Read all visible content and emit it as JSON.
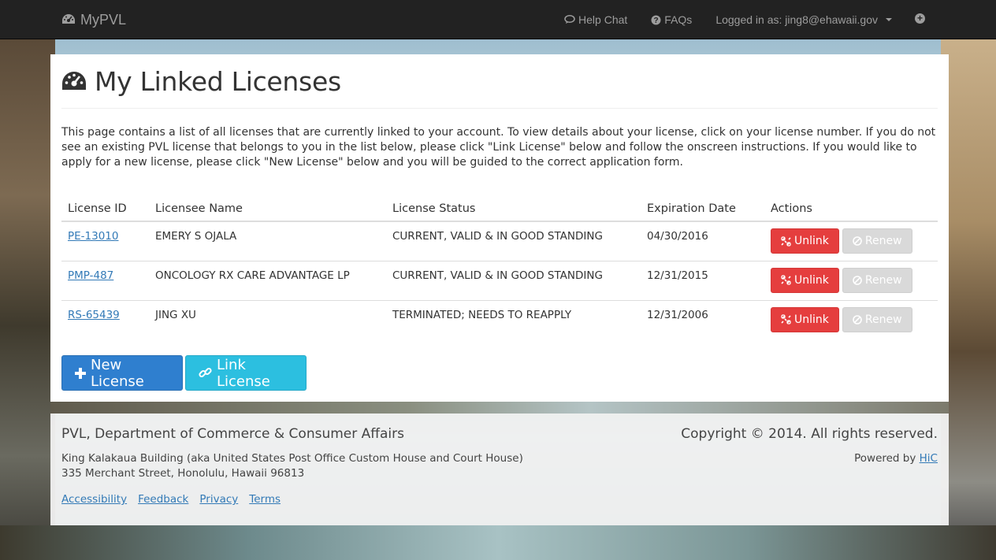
{
  "navbar": {
    "brand": "MyPVL",
    "help_chat": "Help Chat",
    "faqs": "FAQs",
    "logged_in": "Logged in as: jing8@ehawaii.gov"
  },
  "page": {
    "title": "My Linked Licenses",
    "intro": "This page contains a list of all licenses that are currently linked to your account. To view details about your license, click on your license number. If you do not see an existing PVL license that belongs to you in the list below, please click \"Link License\" below and follow the onscreen instructions. If you would like to apply for a new license, please click \"New License\" below and you will be guided to the correct application form."
  },
  "table": {
    "headers": [
      "License ID",
      "Licensee Name",
      "License Status",
      "Expiration Date",
      "Actions"
    ],
    "rows": [
      {
        "id": "PE-13010",
        "name": "EMERY S OJALA",
        "status": "CURRENT, VALID & IN GOOD STANDING",
        "expiration": "04/30/2016"
      },
      {
        "id": "PMP-487",
        "name": "ONCOLOGY RX CARE ADVANTAGE LP",
        "status": "CURRENT, VALID & IN GOOD STANDING",
        "expiration": "12/31/2015"
      },
      {
        "id": "RS-65439",
        "name": "JING XU",
        "status": "TERMINATED; NEEDS TO REAPPLY",
        "expiration": "12/31/2006"
      }
    ],
    "unlink_label": "Unlink",
    "renew_label": "Renew"
  },
  "buttons": {
    "new_license": "New License",
    "link_license": "Link License"
  },
  "footer": {
    "org": "PVL, Department of Commerce & Consumer Affairs",
    "copyright": "Copyright © 2014. All rights reserved.",
    "address1": "King Kalakaua Building (aka United States Post Office Custom House and Court House)",
    "address2": "335 Merchant Street, Honolulu, Hawaii 96813",
    "powered_by": "Powered by",
    "powered_link": "HiC",
    "links": [
      "Accessibility",
      "Feedback",
      "Privacy",
      "Terms"
    ]
  },
  "colors": {
    "navbar": "#222222",
    "danger": "#e53e3e",
    "primary": "#2f7fcf",
    "info": "#2cbfe0",
    "link": "#337ab7"
  },
  "icons": {
    "brand": "dashboard-icon",
    "help_chat": "comment-icon",
    "faqs": "question-circle-icon",
    "add": "plus-circle-icon",
    "title": "dashboard-icon",
    "unlink": "chain-broken-icon",
    "renew": "ban-icon",
    "new_license": "plus-icon",
    "link_license": "link-icon"
  }
}
